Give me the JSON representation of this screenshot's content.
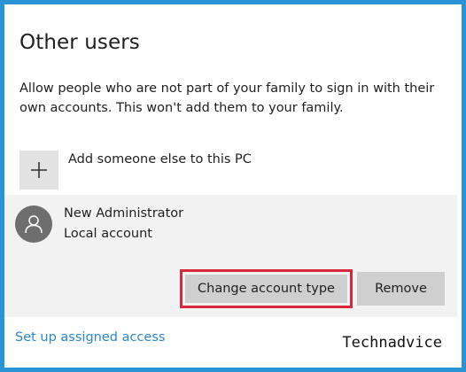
{
  "page": {
    "title": "Other users",
    "description": "Allow people who are not part of your family to sign in with their own accounts. This won't add them to your family."
  },
  "add_user": {
    "icon": "plus-icon",
    "label": "Add someone else to this PC"
  },
  "account": {
    "icon": "person-icon",
    "name": "New Administrator",
    "type": "Local account",
    "change_type_label": "Change account type",
    "remove_label": "Remove"
  },
  "assigned_access": {
    "label": "Set up assigned access"
  },
  "watermark": "Technadvice",
  "colors": {
    "frame_border": "#2a93d5",
    "highlight_box": "#d8283a",
    "link": "#2b86c5",
    "panel_bg": "#f2f2f2",
    "button_bg": "#cfcfcf"
  }
}
